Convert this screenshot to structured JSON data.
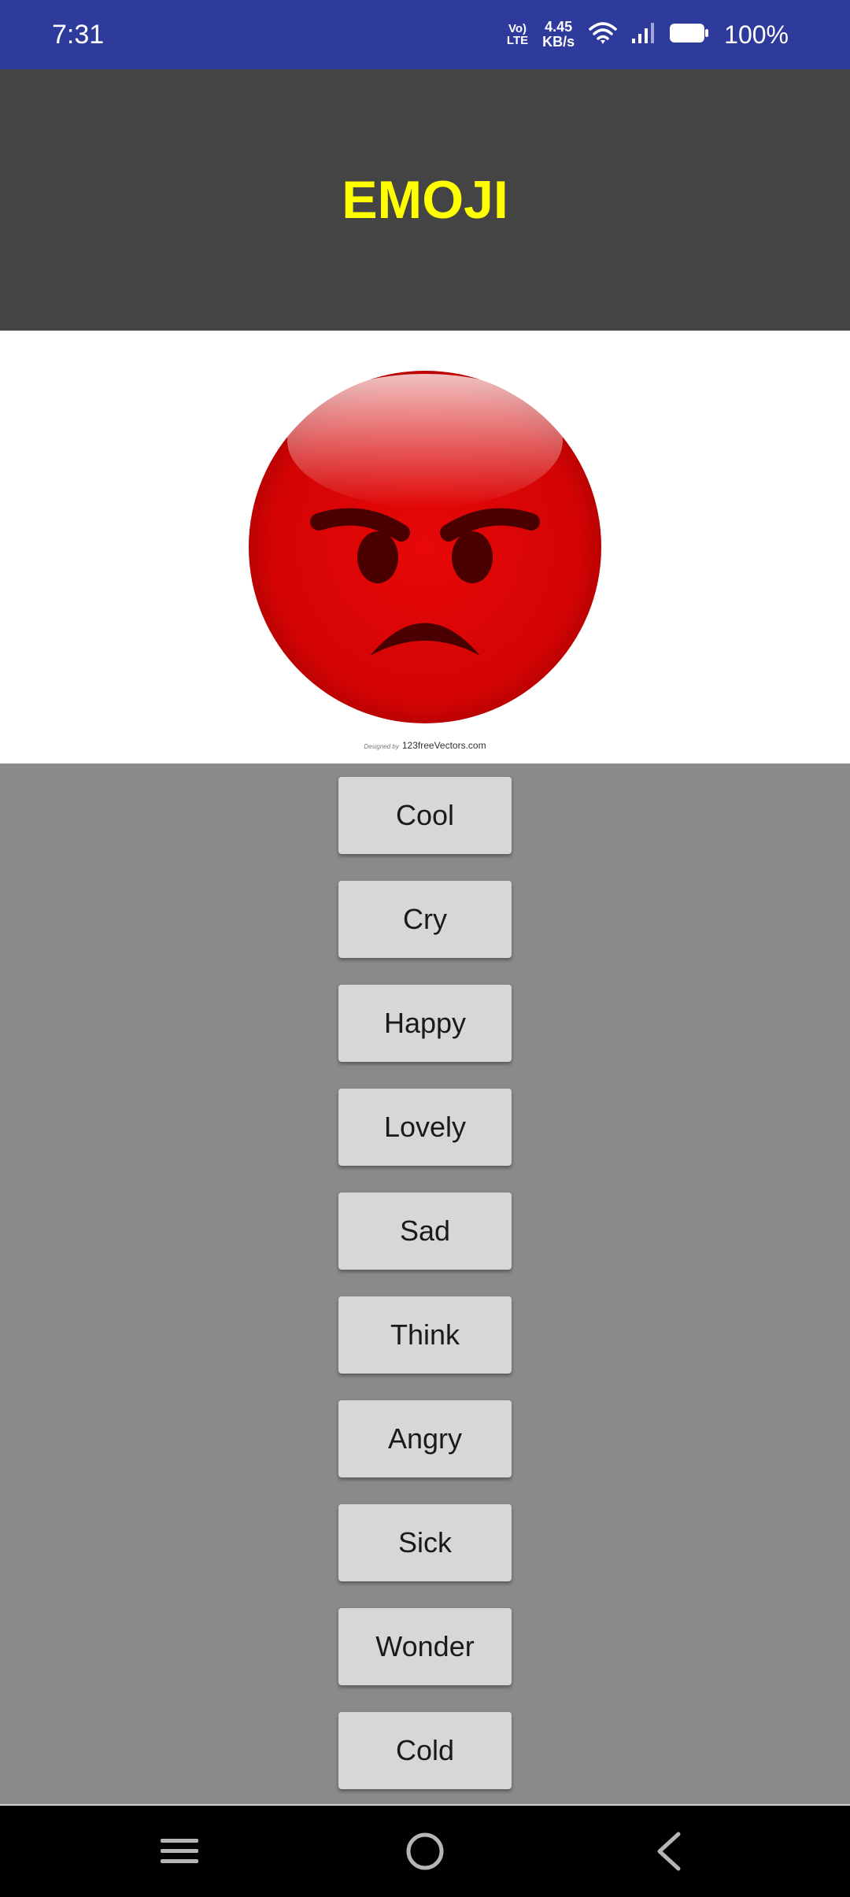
{
  "status_bar": {
    "time": "7:31",
    "volte_top": "Vo)",
    "volte_bottom": "LTE",
    "speed_value": "4.45",
    "speed_unit": "KB/s",
    "battery": "100%",
    "icons": [
      "wifi-icon",
      "signal-icon",
      "battery-icon"
    ]
  },
  "header": {
    "title": "EMOJI",
    "title_color": "#ffff00",
    "background": "#444444"
  },
  "image": {
    "emoji": "angry-face",
    "credit_prefix": "Designed by",
    "credit_site": "123freeVectors.com"
  },
  "buttons": [
    "Cool",
    "Cry",
    "Happy",
    "Lovely",
    "Sad",
    "Think",
    "Angry",
    "Sick",
    "Wonder",
    "Cold"
  ],
  "nav_bar": {
    "icons": [
      "menu-icon",
      "home-icon",
      "back-icon"
    ]
  },
  "colors": {
    "status_bar": "#2e3a9c",
    "content_background": "#8a8a8a",
    "button_background": "#d6d7d7"
  }
}
